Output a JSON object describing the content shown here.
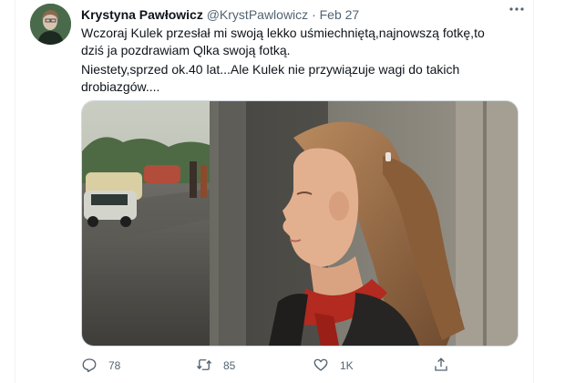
{
  "tweet": {
    "author_name": "Krystyna Pawłowicz",
    "handle": "@KrystPawlowicz",
    "separator": "·",
    "date": "Feb 27",
    "more_icon": "more-horizontal-icon",
    "paragraph1": "Wczoraj Kulek przesłał mi swoją lekko uśmiechniętą,najnowszą fotkę,to dziś ja pozdrawiam Qlka swoją fotką.",
    "paragraph2": "Niestety,sprzed ok.40 lat...Ale Kulek nie przywiązuje wagi do takich drobiazgów...."
  },
  "actions": {
    "reply": {
      "icon": "reply-icon",
      "count": "78"
    },
    "retweet": {
      "icon": "retweet-icon",
      "count": "85"
    },
    "like": {
      "icon": "like-icon",
      "count": "1K"
    },
    "share": {
      "icon": "share-icon"
    }
  },
  "colors": {
    "text_primary": "#0f1419",
    "text_secondary": "#536471",
    "border": "#cfd9de"
  }
}
